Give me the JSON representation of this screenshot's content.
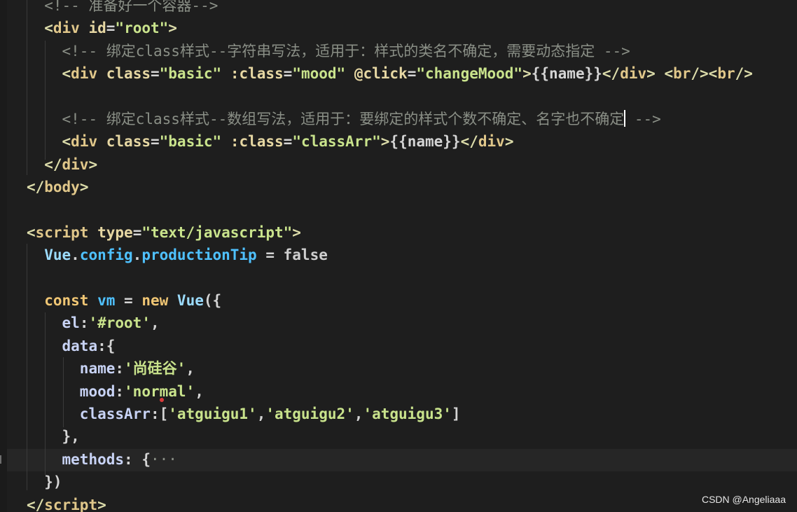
{
  "code_lines": [
    {
      "indent": "  ",
      "parts": [
        {
          "cls": "cmt",
          "text": "<!-- 准备好一个容器-->"
        }
      ]
    },
    {
      "indent": "  ",
      "parts": [
        {
          "cls": "t",
          "text": "<"
        },
        {
          "cls": "tag",
          "text": "div"
        },
        {
          "cls": "pl",
          "text": " "
        },
        {
          "cls": "attr",
          "text": "id"
        },
        {
          "cls": "pl",
          "text": "="
        },
        {
          "cls": "str",
          "text": "\"root\""
        },
        {
          "cls": "t",
          "text": ">"
        }
      ]
    },
    {
      "indent": "    ",
      "parts": [
        {
          "cls": "cmt",
          "text": "<!-- 绑定class样式--字符串写法，适用于：样式的类名不确定，需要动态指定 -->"
        }
      ]
    },
    {
      "indent": "    ",
      "parts": [
        {
          "cls": "t",
          "text": "<"
        },
        {
          "cls": "tag",
          "text": "div"
        },
        {
          "cls": "pl",
          "text": " "
        },
        {
          "cls": "attr",
          "text": "class"
        },
        {
          "cls": "pl",
          "text": "="
        },
        {
          "cls": "str",
          "text": "\"basic\""
        },
        {
          "cls": "pl",
          "text": " "
        },
        {
          "cls": "attr",
          "text": ":class"
        },
        {
          "cls": "pl",
          "text": "="
        },
        {
          "cls": "str",
          "text": "\"mood\""
        },
        {
          "cls": "pl",
          "text": " "
        },
        {
          "cls": "attr",
          "text": "@click"
        },
        {
          "cls": "pl",
          "text": "="
        },
        {
          "cls": "str",
          "text": "\"changeMood\""
        },
        {
          "cls": "t",
          "text": ">"
        },
        {
          "cls": "pl",
          "text": "{{name}}"
        },
        {
          "cls": "t",
          "text": "</"
        },
        {
          "cls": "tag",
          "text": "div"
        },
        {
          "cls": "t",
          "text": ">"
        },
        {
          "cls": "pl",
          "text": " "
        },
        {
          "cls": "t",
          "text": "<"
        },
        {
          "cls": "tag",
          "text": "br"
        },
        {
          "cls": "t",
          "text": "/><"
        },
        {
          "cls": "tag",
          "text": "br"
        },
        {
          "cls": "t",
          "text": "/>"
        }
      ]
    },
    {
      "indent": "",
      "parts": []
    },
    {
      "indent": "    ",
      "parts": [
        {
          "cls": "cmt",
          "text": "<!-- 绑定class样式--数组写法，适用于：要绑定的样式个数不确定、名字也不确定"
        },
        {
          "cls": "cursor",
          "text": ""
        },
        {
          "cls": "cmt",
          "text": " -->"
        }
      ]
    },
    {
      "indent": "    ",
      "parts": [
        {
          "cls": "t",
          "text": "<"
        },
        {
          "cls": "tag",
          "text": "div"
        },
        {
          "cls": "pl",
          "text": " "
        },
        {
          "cls": "attr",
          "text": "class"
        },
        {
          "cls": "pl",
          "text": "="
        },
        {
          "cls": "str",
          "text": "\"basic\""
        },
        {
          "cls": "pl",
          "text": " "
        },
        {
          "cls": "attr",
          "text": ":class"
        },
        {
          "cls": "pl",
          "text": "="
        },
        {
          "cls": "str",
          "text": "\"classArr\""
        },
        {
          "cls": "t",
          "text": ">"
        },
        {
          "cls": "pl",
          "text": "{{name}}"
        },
        {
          "cls": "t",
          "text": "</"
        },
        {
          "cls": "tag",
          "text": "div"
        },
        {
          "cls": "t",
          "text": ">"
        }
      ]
    },
    {
      "indent": "  ",
      "parts": [
        {
          "cls": "t",
          "text": "</"
        },
        {
          "cls": "tag",
          "text": "div"
        },
        {
          "cls": "t",
          "text": ">"
        }
      ]
    },
    {
      "indent": "",
      "parts": [
        {
          "cls": "t",
          "text": "</"
        },
        {
          "cls": "tag",
          "text": "body"
        },
        {
          "cls": "t",
          "text": ">"
        }
      ]
    },
    {
      "indent": "",
      "parts": []
    },
    {
      "indent": "",
      "parts": [
        {
          "cls": "t",
          "text": "<"
        },
        {
          "cls": "tag",
          "text": "script"
        },
        {
          "cls": "pl",
          "text": " "
        },
        {
          "cls": "attr",
          "text": "type"
        },
        {
          "cls": "pl",
          "text": "="
        },
        {
          "cls": "str",
          "text": "\"text/javascript\""
        },
        {
          "cls": "t",
          "text": ">"
        }
      ]
    },
    {
      "indent": "  ",
      "parts": [
        {
          "cls": "vue-var",
          "text": "Vue"
        },
        {
          "cls": "pl",
          "text": "."
        },
        {
          "cls": "prop",
          "text": "config"
        },
        {
          "cls": "pl",
          "text": "."
        },
        {
          "cls": "prop",
          "text": "productionTip"
        },
        {
          "cls": "pl",
          "text": " = "
        },
        {
          "cls": "bool",
          "text": "false"
        }
      ]
    },
    {
      "indent": "",
      "parts": []
    },
    {
      "indent": "  ",
      "parts": [
        {
          "cls": "kw",
          "text": "const"
        },
        {
          "cls": "pl",
          "text": " "
        },
        {
          "cls": "prop",
          "text": "vm"
        },
        {
          "cls": "pl",
          "text": " = "
        },
        {
          "cls": "kw",
          "text": "new"
        },
        {
          "cls": "pl",
          "text": " "
        },
        {
          "cls": "vue-var",
          "text": "Vue"
        },
        {
          "cls": "pl",
          "text": "({"
        }
      ]
    },
    {
      "indent": "    ",
      "parts": [
        {
          "cls": "key",
          "text": "el"
        },
        {
          "cls": "pl",
          "text": ":"
        },
        {
          "cls": "str",
          "text": "'#root'"
        },
        {
          "cls": "pl",
          "text": ","
        }
      ]
    },
    {
      "indent": "    ",
      "parts": [
        {
          "cls": "key",
          "text": "data"
        },
        {
          "cls": "pl",
          "text": ":{"
        }
      ]
    },
    {
      "indent": "      ",
      "parts": [
        {
          "cls": "key",
          "text": "name"
        },
        {
          "cls": "pl",
          "text": ":"
        },
        {
          "cls": "str",
          "text": "'尚硅谷'"
        },
        {
          "cls": "pl",
          "text": ","
        }
      ]
    },
    {
      "indent": "      ",
      "parts": [
        {
          "cls": "key",
          "text": "mood"
        },
        {
          "cls": "pl",
          "text": ":"
        },
        {
          "cls": "str",
          "text": "'normal'"
        },
        {
          "cls": "pl",
          "text": ","
        }
      ]
    },
    {
      "indent": "      ",
      "parts": [
        {
          "cls": "key",
          "text": "classArr"
        },
        {
          "cls": "pl",
          "text": ":["
        },
        {
          "cls": "str",
          "text": "'atguigu1'"
        },
        {
          "cls": "pl",
          "text": ","
        },
        {
          "cls": "str",
          "text": "'atguigu2'"
        },
        {
          "cls": "pl",
          "text": ","
        },
        {
          "cls": "str",
          "text": "'atguigu3'"
        },
        {
          "cls": "pl",
          "text": "]"
        }
      ]
    },
    {
      "indent": "    ",
      "parts": [
        {
          "cls": "pl",
          "text": "},"
        }
      ]
    },
    {
      "indent": "    ",
      "parts": [
        {
          "cls": "key",
          "text": "methods"
        },
        {
          "cls": "pl",
          "text": ": {"
        },
        {
          "cls": "cmt",
          "text": "···"
        }
      ]
    },
    {
      "indent": "  ",
      "parts": [
        {
          "cls": "pl",
          "text": "})"
        }
      ]
    },
    {
      "indent": "",
      "parts": [
        {
          "cls": "t",
          "text": "</"
        },
        {
          "cls": "tag",
          "text": "script"
        },
        {
          "cls": "t",
          "text": ">"
        }
      ]
    }
  ],
  "watermark": "CSDN @Angeliaaa"
}
